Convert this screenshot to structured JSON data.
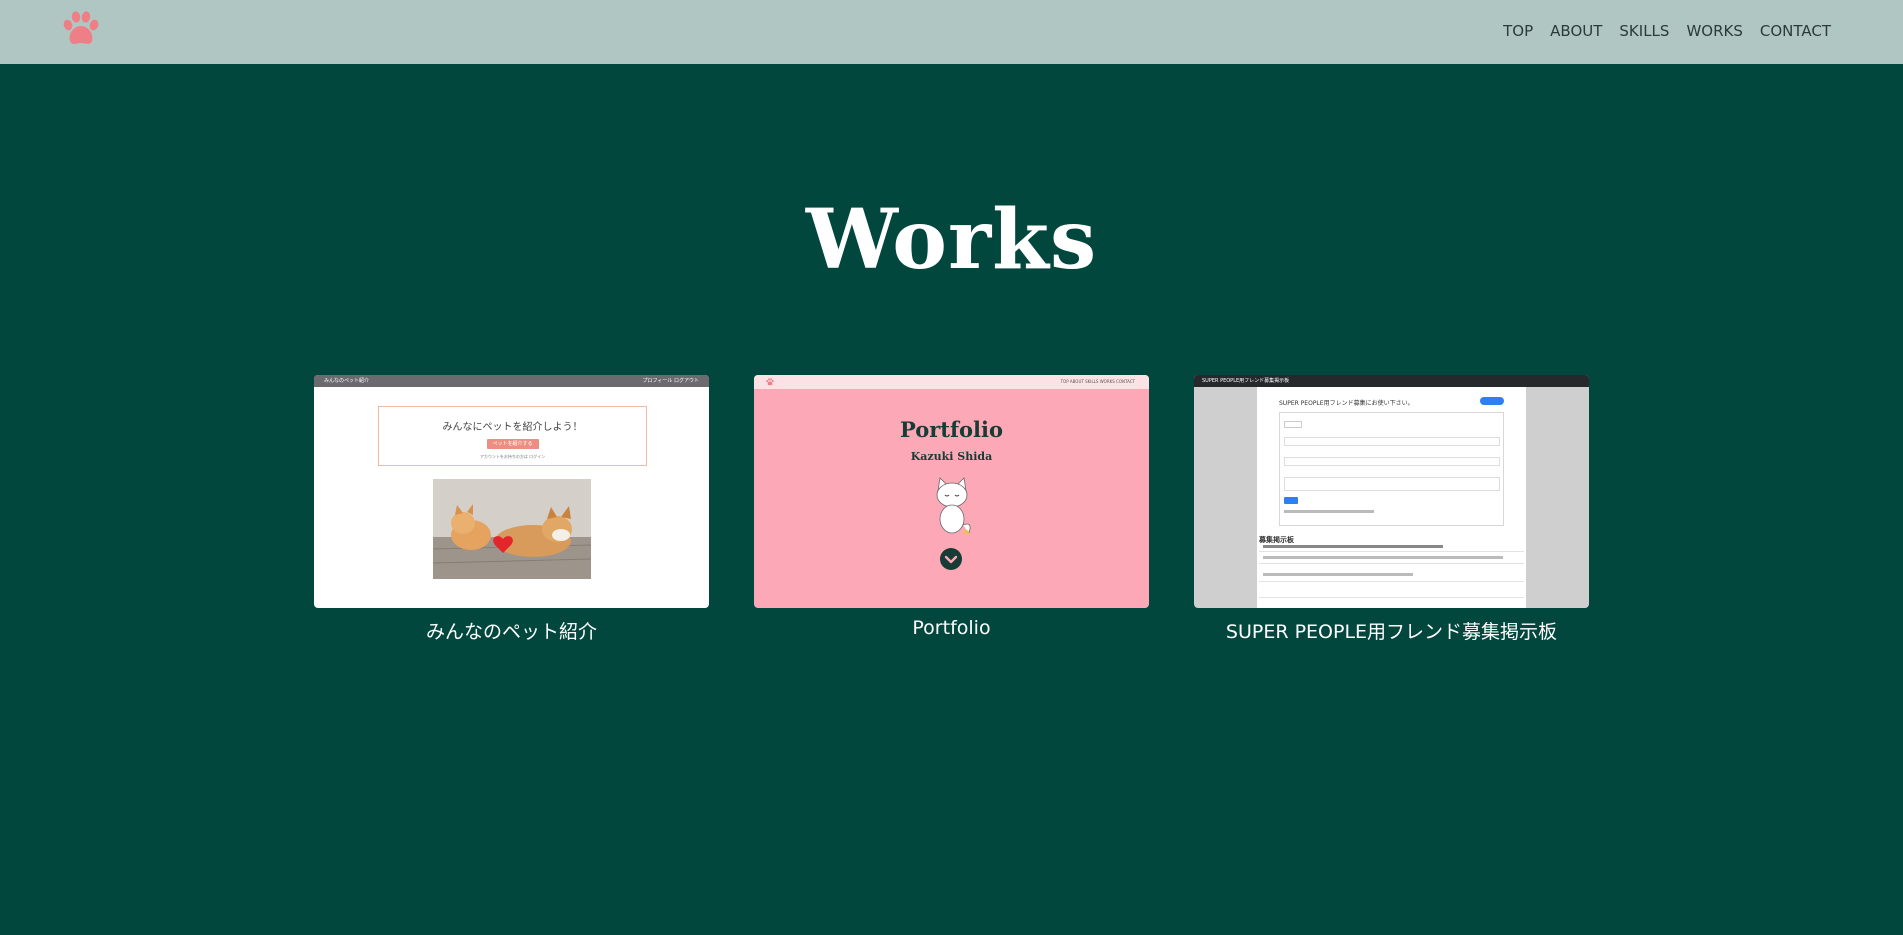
{
  "header": {
    "logo_icon": "paw-icon",
    "logo_color": "#ef7f87",
    "nav": [
      "TOP",
      "ABOUT",
      "SKILLS",
      "WORKS",
      "CONTACT"
    ]
  },
  "title": "Works",
  "works": [
    {
      "caption": "みんなのペット紹介",
      "thumb": {
        "bar_left": "みんなのペット紹介",
        "bar_right": "プロフィール  ログアウト",
        "heading": "みんなにペットを紹介しよう！",
        "button": "ペットを紹介する",
        "sub": "アカウントをお持ちの方は ログイン"
      }
    },
    {
      "caption": "Portfolio",
      "thumb": {
        "nav": "TOP  ABOUT  SKILLS  WORKS  CONTACT",
        "title": "Portfolio",
        "name": "Kazuki Shida"
      }
    },
    {
      "caption": "SUPER PEOPLE用フレンド募集掲示板",
      "thumb": {
        "bar_left": "SUPER PEOPLE用フレンド募集掲示板",
        "heading": "SUPER PEOPLE用フレンド募集にお使い下さい。",
        "section": "募集掲示板"
      }
    }
  ]
}
